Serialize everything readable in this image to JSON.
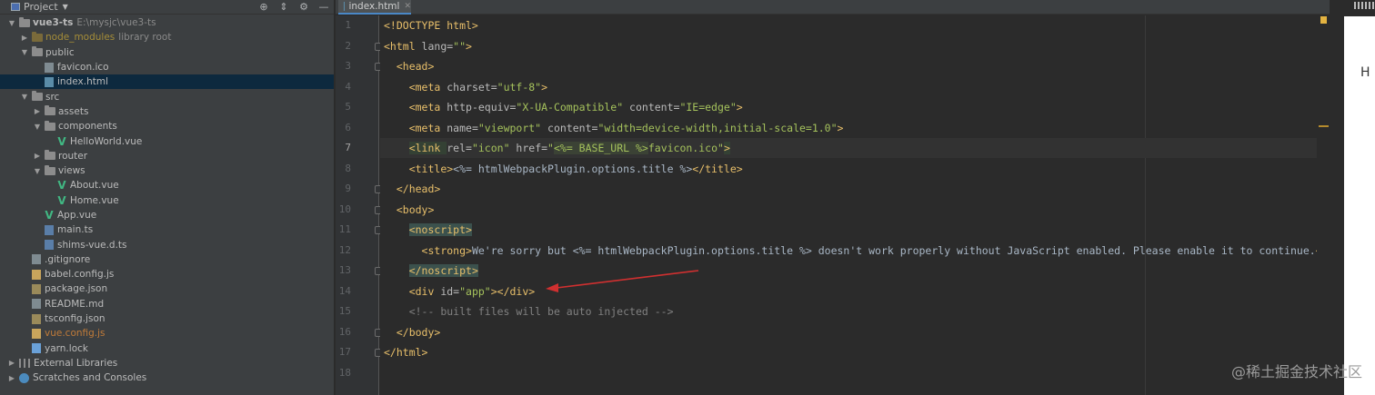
{
  "project_panel": {
    "title": "Project",
    "tools": [
      "⊕",
      "⇕",
      "⚙",
      "—"
    ],
    "tree": [
      {
        "label": "vue3-ts",
        "extra": "E:\\mysjc\\vue3-ts",
        "depth": 0,
        "kind": "folder",
        "expanded": true,
        "bold": true
      },
      {
        "label": "node_modules",
        "extra": "library root",
        "depth": 1,
        "kind": "folder-excluded",
        "expanded": false
      },
      {
        "label": "public",
        "depth": 1,
        "kind": "folder",
        "expanded": true
      },
      {
        "label": "favicon.ico",
        "depth": 2,
        "kind": "file-ico"
      },
      {
        "label": "index.html",
        "depth": 2,
        "kind": "file-html",
        "selected": true
      },
      {
        "label": "src",
        "depth": 1,
        "kind": "folder",
        "expanded": true
      },
      {
        "label": "assets",
        "depth": 2,
        "kind": "folder",
        "expanded": false
      },
      {
        "label": "components",
        "depth": 2,
        "kind": "folder",
        "expanded": true
      },
      {
        "label": "HelloWorld.vue",
        "depth": 3,
        "kind": "vue"
      },
      {
        "label": "router",
        "depth": 2,
        "kind": "folder",
        "expanded": false
      },
      {
        "label": "views",
        "depth": 2,
        "kind": "folder",
        "expanded": true
      },
      {
        "label": "About.vue",
        "depth": 3,
        "kind": "vue"
      },
      {
        "label": "Home.vue",
        "depth": 3,
        "kind": "vue"
      },
      {
        "label": "App.vue",
        "depth": 2,
        "kind": "vue"
      },
      {
        "label": "main.ts",
        "depth": 2,
        "kind": "file-ts"
      },
      {
        "label": "shims-vue.d.ts",
        "depth": 2,
        "kind": "file-ts"
      },
      {
        "label": ".gitignore",
        "depth": 1,
        "kind": "file-ico"
      },
      {
        "label": "babel.config.js",
        "depth": 1,
        "kind": "file-js"
      },
      {
        "label": "package.json",
        "depth": 1,
        "kind": "file-json"
      },
      {
        "label": "README.md",
        "depth": 1,
        "kind": "file-md"
      },
      {
        "label": "tsconfig.json",
        "depth": 1,
        "kind": "file-json"
      },
      {
        "label": "vue.config.js",
        "depth": 1,
        "kind": "file-js",
        "orange": true
      },
      {
        "label": "yarn.lock",
        "depth": 1,
        "kind": "file-lock"
      },
      {
        "label": "External Libraries",
        "depth": 0,
        "kind": "lib",
        "expanded": false
      },
      {
        "label": "Scratches and Consoles",
        "depth": 0,
        "kind": "scratch",
        "expanded": false
      }
    ]
  },
  "editor": {
    "tab_label": "index.html",
    "current_line": 7,
    "lines": [
      [
        [
          "t",
          "<!DOCTYPE html>"
        ]
      ],
      [
        [
          "t",
          "<html "
        ],
        [
          "a",
          "lang="
        ],
        [
          "v",
          "\"\""
        ],
        [
          "t",
          ">"
        ]
      ],
      [
        [
          "x",
          "  "
        ],
        [
          "t",
          "<head>"
        ]
      ],
      [
        [
          "x",
          "    "
        ],
        [
          "t",
          "<meta "
        ],
        [
          "a",
          "charset="
        ],
        [
          "v",
          "\"utf-8\""
        ],
        [
          "t",
          ">"
        ]
      ],
      [
        [
          "x",
          "    "
        ],
        [
          "t",
          "<meta "
        ],
        [
          "a",
          "http-equiv="
        ],
        [
          "v",
          "\"X-UA-Compatible\""
        ],
        [
          "a",
          " content="
        ],
        [
          "v",
          "\"IE=edge\""
        ],
        [
          "t",
          ">"
        ]
      ],
      [
        [
          "x",
          "    "
        ],
        [
          "t",
          "<meta "
        ],
        [
          "a",
          "name="
        ],
        [
          "v",
          "\"viewport\""
        ],
        [
          "a",
          " content="
        ],
        [
          "v",
          "\"width=device-width,initial-scale=1.0\""
        ],
        [
          "t",
          ">"
        ]
      ],
      [
        [
          "x",
          "    "
        ],
        [
          "th",
          "<link "
        ],
        [
          "a",
          "rel="
        ],
        [
          "v",
          "\"icon\""
        ],
        [
          "a",
          " href="
        ],
        [
          "v",
          "\""
        ],
        [
          "tmpl",
          "<%= BASE_URL %>"
        ],
        [
          "v",
          "favicon.ico\""
        ],
        [
          "th",
          ">"
        ]
      ],
      [
        [
          "x",
          "    "
        ],
        [
          "t",
          "<title>"
        ],
        [
          "x",
          "<%= htmlWebpackPlugin.options.title %>"
        ],
        [
          "t",
          "</title>"
        ]
      ],
      [
        [
          "x",
          "  "
        ],
        [
          "t",
          "</head>"
        ]
      ],
      [
        [
          "x",
          "  "
        ],
        [
          "t",
          "<body>"
        ]
      ],
      [
        [
          "x",
          "    "
        ],
        [
          "tg",
          "<noscript>"
        ]
      ],
      [
        [
          "x",
          "      "
        ],
        [
          "t",
          "<strong>"
        ],
        [
          "x",
          "We're sorry but <%= htmlWebpackPlugin.options.title %> doesn't work properly without JavaScript enabled. Please enable it to continue."
        ],
        [
          "t",
          "<"
        ]
      ],
      [
        [
          "x",
          "    "
        ],
        [
          "tg",
          "</noscript>"
        ]
      ],
      [
        [
          "x",
          "    "
        ],
        [
          "t",
          "<div "
        ],
        [
          "a",
          "id="
        ],
        [
          "v",
          "\"app\""
        ],
        [
          "t",
          "></div>"
        ]
      ],
      [
        [
          "x",
          "    "
        ],
        [
          "c",
          "<!-- built files will be auto injected -->"
        ]
      ],
      [
        [
          "x",
          "  "
        ],
        [
          "t",
          "</body>"
        ]
      ],
      [
        [
          "t",
          "</html>"
        ]
      ],
      []
    ]
  },
  "right_strip": {
    "letter": "H"
  },
  "watermark": "@稀土掘金技术社区"
}
